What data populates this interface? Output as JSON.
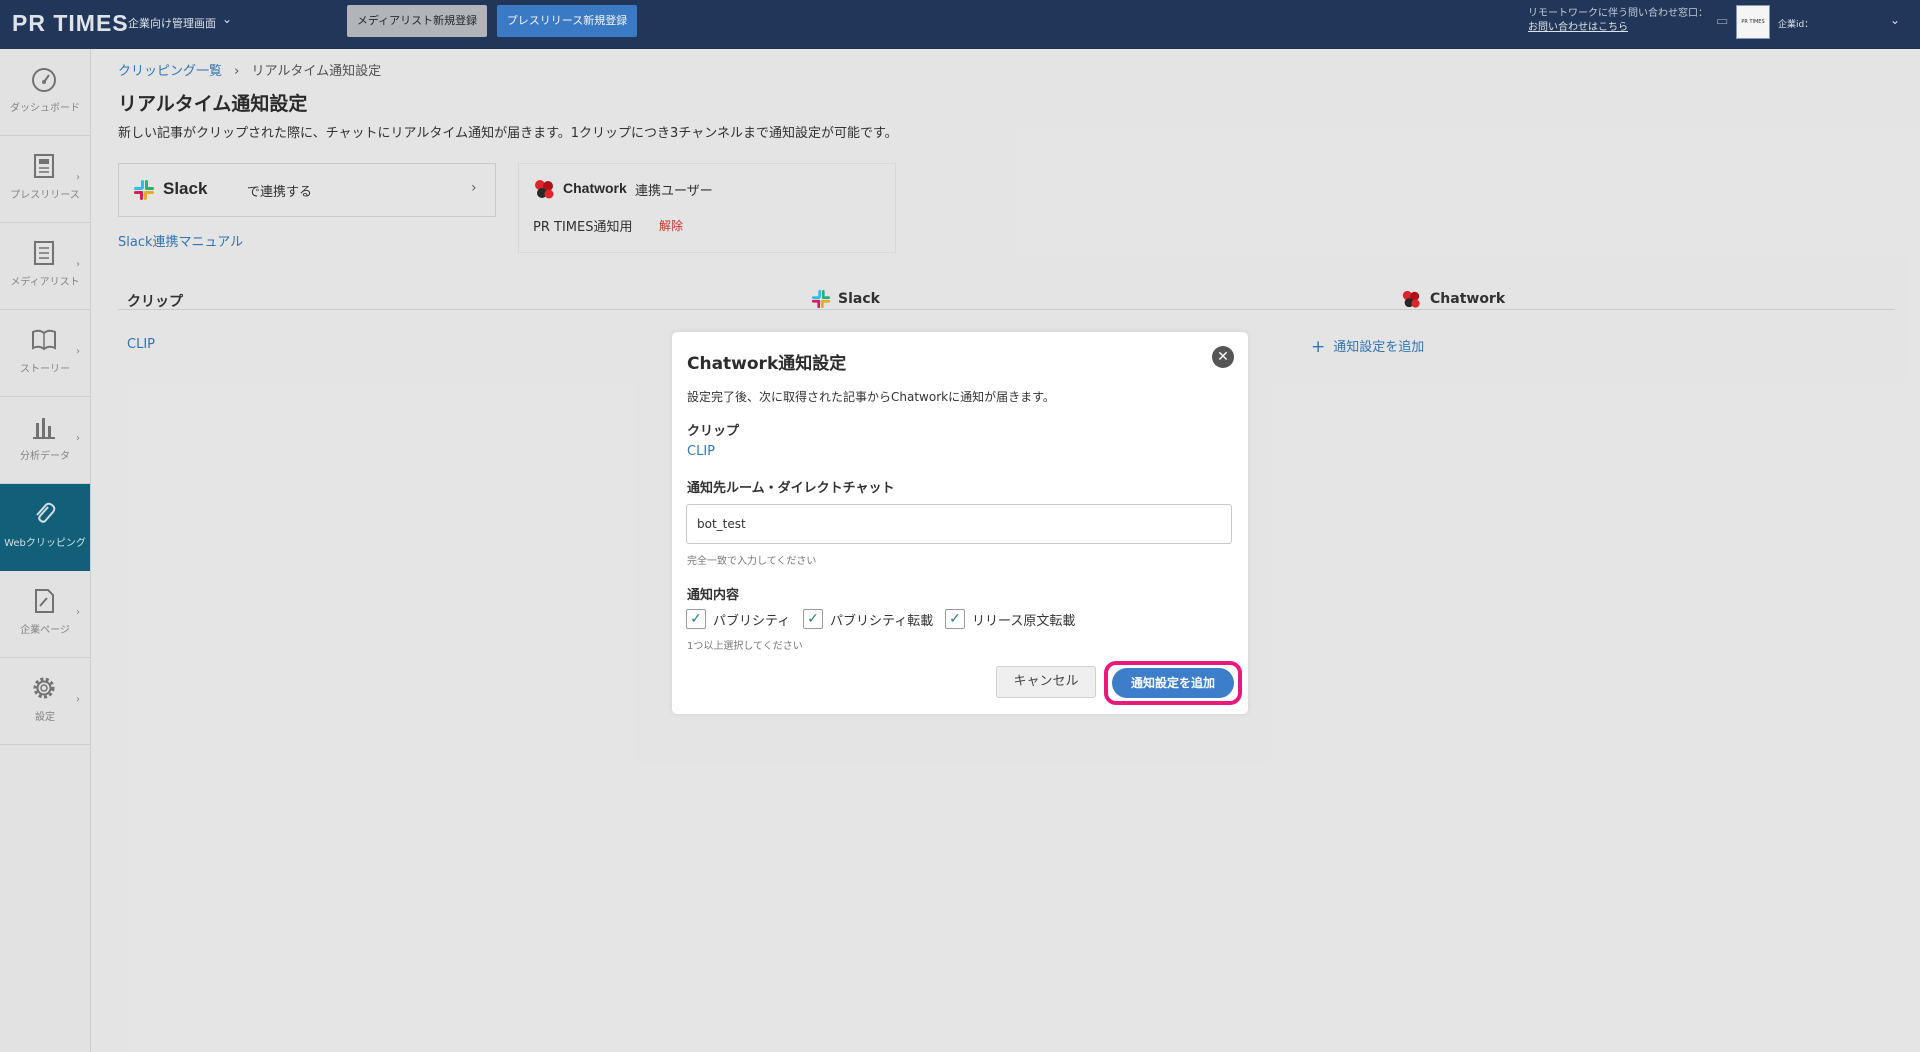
{
  "header": {
    "logo": "PR TIMES",
    "admin_label": "企業向け管理画面",
    "medialist_button": "メディアリスト新規登録",
    "pressrelease_button": "プレスリリース新規登録",
    "remote_text": "リモートワークに伴う問い合わせ窓口：",
    "remote_link": "お問い合わせはこちら",
    "company_logo": "PR TIMES",
    "company_id": "企業id："
  },
  "sidebar": {
    "items": [
      {
        "label": "ダッシュボード",
        "icon": "dashboard-icon"
      },
      {
        "label": "プレスリリース",
        "icon": "document-icon"
      },
      {
        "label": "メディアリスト",
        "icon": "list-icon"
      },
      {
        "label": "ストーリー",
        "icon": "book-icon"
      },
      {
        "label": "分析データ",
        "icon": "bar-chart-icon"
      },
      {
        "label": "Webクリッピング",
        "icon": "paperclip-icon"
      },
      {
        "label": "企業ページ",
        "icon": "page-icon"
      },
      {
        "label": "設定",
        "icon": "gear-icon"
      }
    ]
  },
  "breadcrumb": {
    "parent": "クリッピング一覧",
    "separator": "›",
    "current": "リアルタイム通知設定"
  },
  "page": {
    "title": "リアルタイム通知設定",
    "description": "新しい記事がクリップされた際に、チャットにリアルタイム通知が届きます。1クリップにつき3チャンネルまで通知設定が可能です。"
  },
  "slack_card": {
    "name": "Slack",
    "action": "で連携する",
    "manual_link": "Slack連携マニュアル"
  },
  "chatwork_card": {
    "name": "Chatwork",
    "user_label": "連携ユーザー",
    "user_name": "PR TIMES通知用",
    "remove": "解除"
  },
  "table": {
    "col_clip": "クリップ",
    "col_slack": "Slack",
    "col_chatwork": "Chatwork",
    "rows": [
      {
        "clip": "CLIP",
        "chatwork_action": "通知設定を追加"
      }
    ]
  },
  "modal": {
    "title": "Chatwork通知設定",
    "intro": "設定完了後、次に取得された記事からChatworkに通知が届きます。",
    "clip_label": "クリップ",
    "clip_value": "CLIP",
    "room_label": "通知先ルーム・ダイレクトチャット",
    "room_value": "bot_test",
    "room_hint": "完全一致で入力してください",
    "content_label": "通知内容",
    "options": [
      {
        "label": "パブリシティ",
        "checked": true
      },
      {
        "label": "パブリシティ転載",
        "checked": true
      },
      {
        "label": "リリース原文転載",
        "checked": true
      }
    ],
    "options_hint": "1つ以上選択してください",
    "cancel": "キャンセル",
    "submit": "通知設定を追加"
  },
  "colors": {
    "header_bg": "#23395c",
    "accent_blue": "#3d7ecb",
    "sidebar_active": "#12637d",
    "highlight": "#e9197c",
    "remove_red": "#d0342c"
  }
}
